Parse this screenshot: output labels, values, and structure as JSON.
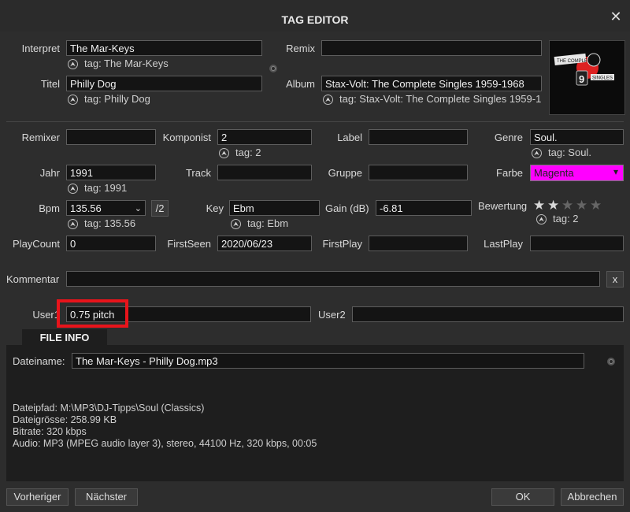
{
  "window": {
    "title": "TAG EDITOR"
  },
  "fields": {
    "interpret": {
      "label": "Interpret",
      "value": "The Mar-Keys",
      "tag": "tag: The Mar-Keys"
    },
    "remix": {
      "label": "Remix",
      "value": ""
    },
    "titel": {
      "label": "Titel",
      "value": "Philly Dog",
      "tag": "tag: Philly Dog"
    },
    "album": {
      "label": "Album",
      "value": "Stax-Volt: The Complete Singles 1959-1968",
      "tag": "tag: Stax-Volt: The Complete Singles 1959-1"
    },
    "remixer": {
      "label": "Remixer",
      "value": ""
    },
    "komponist": {
      "label": "Komponist",
      "value": "2",
      "tag": "tag: 2"
    },
    "label": {
      "label": "Label",
      "value": ""
    },
    "genre": {
      "label": "Genre",
      "value": "Soul.",
      "tag": "tag: Soul."
    },
    "jahr": {
      "label": "Jahr",
      "value": "1991",
      "tag": "tag: 1991"
    },
    "track": {
      "label": "Track",
      "value": ""
    },
    "gruppe": {
      "label": "Gruppe",
      "value": ""
    },
    "farbe": {
      "label": "Farbe",
      "value": "Magenta",
      "color": "#ff00ff"
    },
    "bpm": {
      "label": "Bpm",
      "value": "135.56",
      "tag": "tag: 135.56",
      "half_label": "/2"
    },
    "key": {
      "label": "Key",
      "value": "Ebm",
      "tag": "tag: Ebm"
    },
    "gain": {
      "label": "Gain (dB)",
      "value": "-6.81"
    },
    "bewertung": {
      "label": "Bewertung",
      "rating": 2,
      "max": 5,
      "tag": "tag: 2"
    },
    "playcount": {
      "label": "PlayCount",
      "value": "0"
    },
    "firstseen": {
      "label": "FirstSeen",
      "value": "2020/06/23"
    },
    "firstplay": {
      "label": "FirstPlay",
      "value": ""
    },
    "lastplay": {
      "label": "LastPlay",
      "value": ""
    },
    "kommentar": {
      "label": "Kommentar",
      "value": "",
      "clear_label": "x"
    },
    "user1": {
      "label": "User1",
      "value": "0.75 pitch"
    },
    "user2": {
      "label": "User2",
      "value": ""
    }
  },
  "cover": {
    "line1": "THE COMPLETE",
    "big": "9",
    "line2": "SINGLES"
  },
  "file_info": {
    "tab_label": "FILE INFO",
    "dateiname_label": "Dateiname:",
    "dateiname_value": "The Mar-Keys - Philly Dog.mp3",
    "dateipfad": "Dateipfad: M:\\MP3\\DJ-Tipps\\Soul (Classics)",
    "dateigroesse": "Dateigrösse: 258.99 KB",
    "bitrate": "Bitrate: 320 kbps",
    "audio": "Audio: MP3 (MPEG audio layer 3), stereo, 44100 Hz, 320 kbps, 00:05"
  },
  "buttons": {
    "previous": "Vorheriger",
    "next": "Nächster",
    "ok": "OK",
    "cancel": "Abbrechen"
  },
  "highlight_color": "#e8141b"
}
